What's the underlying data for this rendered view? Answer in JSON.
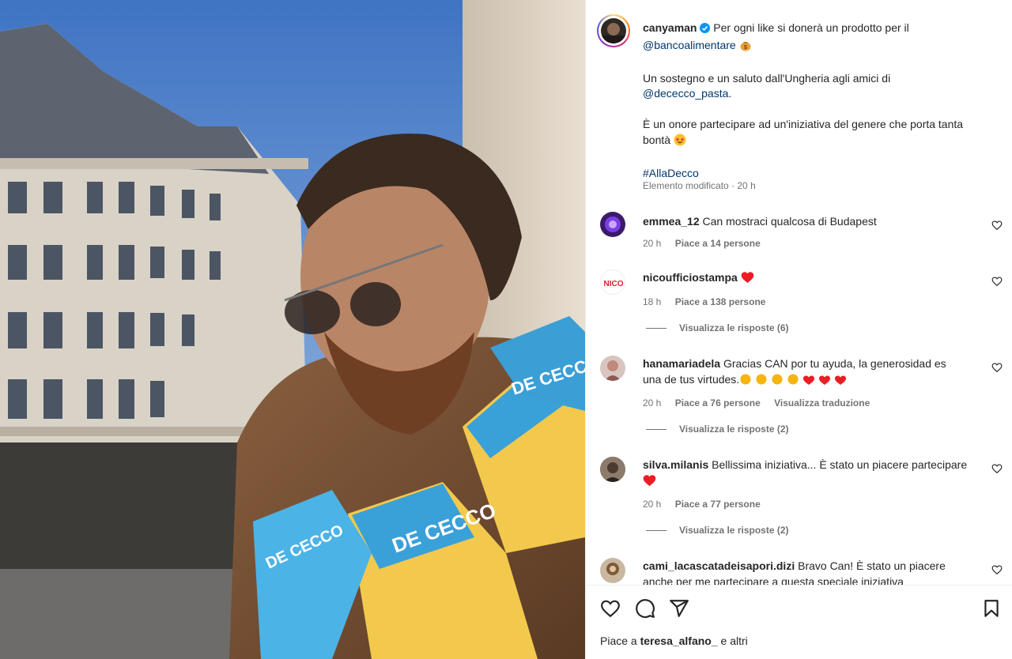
{
  "post": {
    "author": "canyaman",
    "caption_line1": "Per ogni like si donerà un prodotto per il",
    "caption_mention1": "@bancoalimentare",
    "caption_line2": "Un sostegno e un saluto dall'Ungheria agli amici di",
    "caption_mention2": "@dececco_pasta",
    "caption_line3": "È un onore partecipare ad un'iniziativa del genere che porta tanta",
    "caption_line3b": "bontà",
    "hashtag": "#AllaDecco",
    "edited": "Elemento modificato · 20 h"
  },
  "photo": {
    "brand_text": "DE CECCO"
  },
  "comments": [
    {
      "user": "emmea_12",
      "text": "Can mostraci qualcosa di Budapest",
      "time": "20 h",
      "likes": "Piace a 14 persone"
    },
    {
      "user": "nicoufficiostampa",
      "text": "",
      "time": "18 h",
      "likes": "Piace a 138 persone",
      "replies": "Visualizza le risposte (6)",
      "avatar_text": "NICO"
    },
    {
      "user": "hanamariadela",
      "text": "Gracias CAN por tu ayuda, la generosidad es",
      "text2": "una de tus virtudes.",
      "time": "20 h",
      "likes": "Piace a 76 persone",
      "translate": "Visualizza traduzione",
      "replies": "Visualizza le risposte (2)"
    },
    {
      "user": "silva.milanis",
      "text": "Bellissima iniziativa... È stato un piacere partecipare",
      "time": "20 h",
      "likes": "Piace a 77 persone",
      "replies": "Visualizza le risposte (2)"
    },
    {
      "user": "cami_lacascatadeisapori.dizi",
      "text": "Bravo Can! È stato un piacere",
      "text2": "anche per me partecipare a questa speciale iniziativa"
    }
  ],
  "footer": {
    "liked_prefix": "Piace a",
    "liked_user": "teresa_alfano_",
    "liked_suffix": "e altri"
  },
  "colors": {
    "link": "#00376b",
    "muted": "#737373",
    "heart_red": "#ed1c24",
    "verified": "#0095f6"
  }
}
